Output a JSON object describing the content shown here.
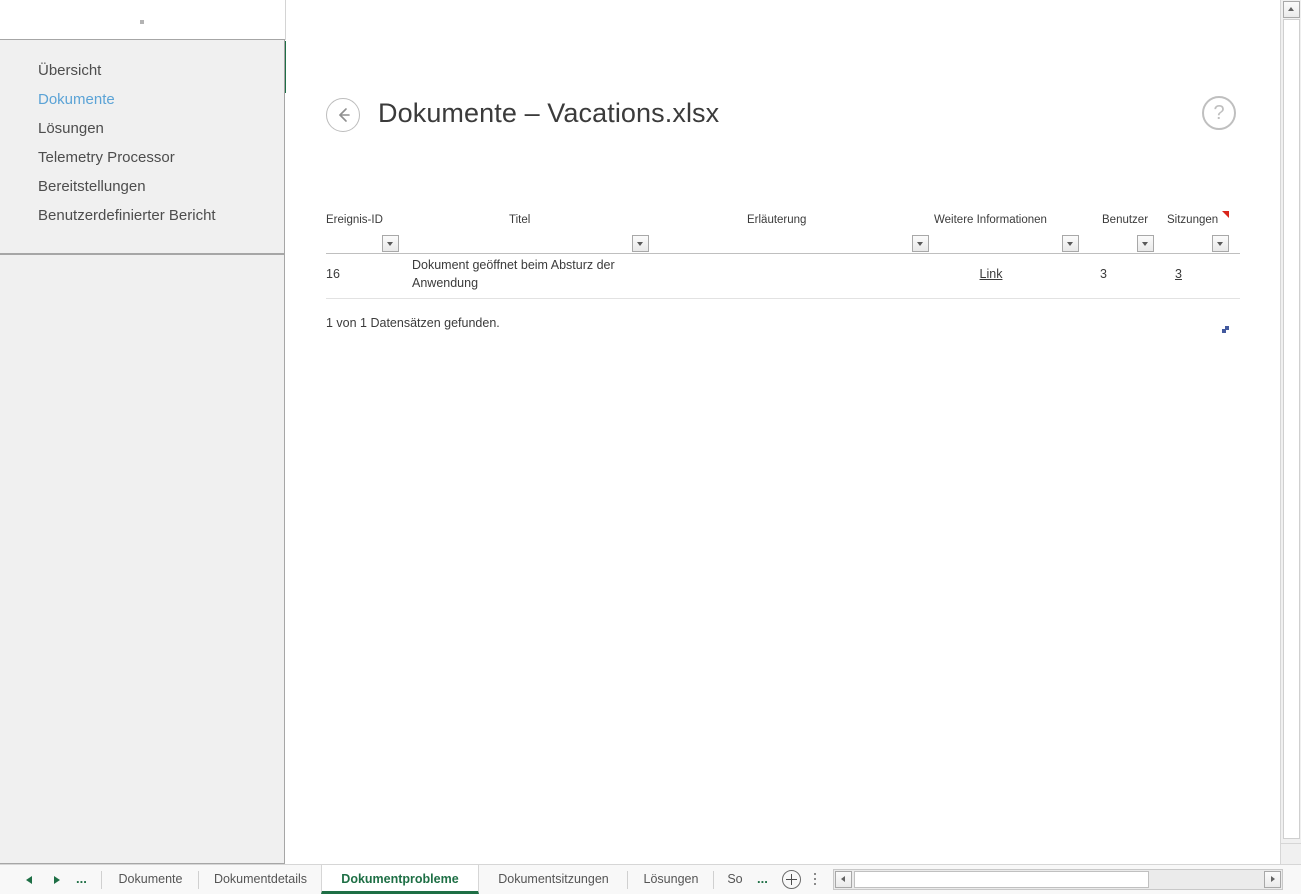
{
  "app": {
    "accent_green": "#1e6f45",
    "link_blue": "#5ba3d6",
    "comment_marker_color": "#d9261c"
  },
  "side_panel": {
    "items": [
      {
        "label": "Übersicht",
        "active": false
      },
      {
        "label": "Dokumente",
        "active": true
      },
      {
        "label": "Lösungen",
        "active": false
      },
      {
        "label": "Telemetry Processor",
        "active": false
      },
      {
        "label": "Bereitstellungen",
        "active": false
      },
      {
        "label": "Benutzerdefinierter Bericht",
        "active": false
      }
    ]
  },
  "report": {
    "back_icon": "back-arrow-icon",
    "title": "Dokumente – Vacations.xlsx",
    "help_icon": "help-question-icon",
    "table": {
      "columns": [
        {
          "header": "Ereignis-ID",
          "filter_icon": "filter-dropdown-icon"
        },
        {
          "header": "Titel",
          "filter_icon": "filter-dropdown-icon"
        },
        {
          "header": "Erläuterung",
          "filter_icon": "filter-dropdown-icon"
        },
        {
          "header": "Weitere Informationen",
          "filter_icon": "filter-dropdown-icon"
        },
        {
          "header": "Benutzer",
          "filter_icon": "filter-dropdown-icon"
        },
        {
          "header": "Sitzungen",
          "filter_icon": "filter-dropdown-icon"
        }
      ],
      "rows": [
        {
          "event_id": "16",
          "title": "Dokument geöffnet beim Absturz der Anwendung",
          "explanation": "",
          "more_info": "Link",
          "users": "3",
          "sessions": "3"
        }
      ]
    },
    "record_count": "1 von 1 Datensätzen gefunden."
  },
  "tab_bar": {
    "prev_icon": "triangle-left-icon",
    "next_icon": "triangle-right-icon",
    "ellipsis_left": "...",
    "ellipsis_right": "...",
    "new_sheet_icon": "plus-circle-icon",
    "overflow_icon": "vertical-dots-icon",
    "tabs": [
      {
        "label": "Dokumente",
        "active": false
      },
      {
        "label": "Dokumentdetails",
        "active": false
      },
      {
        "label": "Dokumentprobleme",
        "active": true
      },
      {
        "label": "Dokumentsitzungen",
        "active": false
      },
      {
        "label": "Lösungen",
        "active": false
      },
      {
        "label": "So",
        "active": false
      }
    ]
  },
  "scrollbars": {
    "v_up_icon": "scroll-up-arrow-icon",
    "v_down_icon": "scroll-down-arrow-icon",
    "h_left_icon": "scroll-left-arrow-icon",
    "h_right_icon": "scroll-right-arrow-icon"
  }
}
